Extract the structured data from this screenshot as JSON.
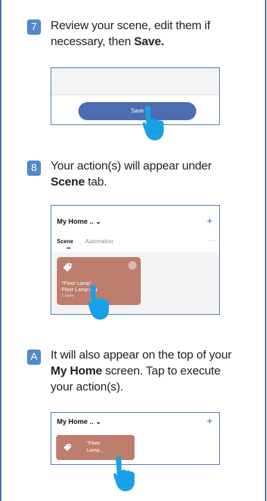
{
  "step7": {
    "badge": "7",
    "line1": "Review your scene, edit them if",
    "line2_prefix": "necessary, then ",
    "line2_bold": "Save.",
    "panel": {
      "save_label": "Save"
    }
  },
  "step8": {
    "badge": "8",
    "line1": "Your action(s) will appear under",
    "line2_bold": "Scene",
    "line2_suffix": " tab.",
    "panel": {
      "title": "My Home .. ⌄",
      "plus": "+",
      "tab_scene": "Scene",
      "tab_automation": "Automation",
      "more": "···",
      "card_line1": "\"Floor Lamp\"",
      "card_line2": "Floor Lamp:ON",
      "card_sub": "1 tasks",
      "card_dots": "···"
    }
  },
  "stepA": {
    "badge": "A",
    "line1": "It will also appear on the top of your",
    "line2_bold": "My Home",
    "line2_suffix": " screen. Tap to execute",
    "line3": "your action(s).",
    "panel": {
      "title": "My Home .. ⌄",
      "plus": "+",
      "card_line1": "\"Floor",
      "card_line2": "Lamp..."
    }
  },
  "colors": {
    "frame": "#3f6fb5",
    "badge": "#5289c9",
    "save_button": "#4d6db0",
    "scene_card": "#bf7d6d",
    "hand": "#1aa0e6"
  },
  "icons": [
    "tag-icon",
    "pointing-hand-icon",
    "plus-icon",
    "more-icon"
  ]
}
